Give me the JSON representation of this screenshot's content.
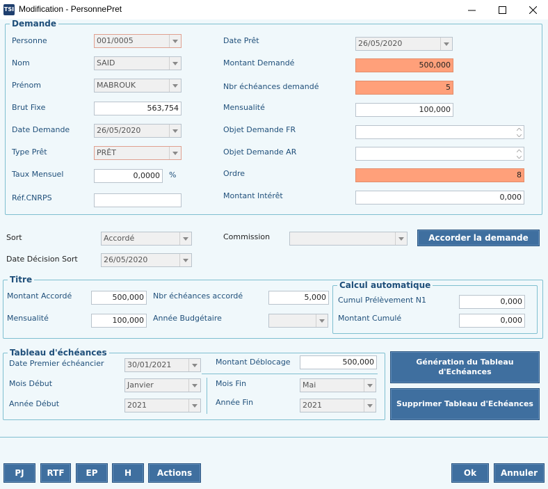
{
  "window": {
    "title": "Modification - PersonnePret",
    "icon_text": "TSI"
  },
  "demande": {
    "legend": "Demande",
    "personne": {
      "label": "Personne",
      "value": "001/0005"
    },
    "nom": {
      "label": "Nom",
      "value": "SAID"
    },
    "prenom": {
      "label": "Prénom",
      "value": "MABROUK"
    },
    "brut_fixe": {
      "label": "Brut Fixe",
      "value": "563,754"
    },
    "date_demande": {
      "label": "Date Demande",
      "value": "26/05/2020"
    },
    "type_pret": {
      "label": "Type Prêt",
      "value": "PRÊT"
    },
    "taux_mensuel": {
      "label": "Taux Mensuel",
      "value": "0,0000",
      "unit": "%"
    },
    "ref_cnrps": {
      "label": "Réf.CNRPS",
      "value": ""
    },
    "date_pret": {
      "label": "Date Prêt",
      "value": "26/05/2020"
    },
    "montant_demande": {
      "label": "Montant Demandé",
      "value": "500,000"
    },
    "nbr_echeances": {
      "label": "Nbr échéances demandé",
      "value": "5"
    },
    "mensualite": {
      "label": "Mensualité",
      "value": "100,000"
    },
    "objet_fr": {
      "label": "Objet Demande FR",
      "value": ""
    },
    "objet_ar": {
      "label": "Objet Demande AR",
      "value": ""
    },
    "ordre": {
      "label": "Ordre",
      "value": "8"
    },
    "montant_interet": {
      "label": "Montant Intérêt",
      "value": "0,000"
    }
  },
  "sort": {
    "sort": {
      "label": "Sort",
      "value": "Accordé"
    },
    "commission": {
      "label": "Commission",
      "value": ""
    },
    "date_decision": {
      "label": "Date Décision Sort",
      "value": "26/05/2020"
    },
    "accorder_label": "Accorder la demande"
  },
  "titre": {
    "legend": "Titre",
    "montant_accorde": {
      "label": "Montant Accordé",
      "value": "500,000"
    },
    "nbr_accorde": {
      "label": "Nbr échéances accordé",
      "value": "5,000"
    },
    "mensualite": {
      "label": "Mensualité",
      "value": "100,000"
    },
    "annee_budgetaire": {
      "label": "Année Budgétaire",
      "value": ""
    }
  },
  "calcul": {
    "legend": "Calcul automatique",
    "cumul": {
      "label": "Cumul Prélèvement N1",
      "value": "0,000"
    },
    "montant_cumule": {
      "label": "Montant Cumulé",
      "value": "0,000"
    }
  },
  "tableau": {
    "legend": "Tableau d'échéances",
    "date_premier": {
      "label": "Date Premier échéancier",
      "value": "30/01/2021"
    },
    "montant_deblocage": {
      "label": "Montant Déblocage",
      "value": "500,000"
    },
    "mois_debut": {
      "label": "Mois Début",
      "value": "Janvier"
    },
    "mois_fin": {
      "label": "Mois Fin",
      "value": "Mai"
    },
    "annee_debut": {
      "label": "Année Début",
      "value": "2021"
    },
    "annee_fin": {
      "label": "Année Fin",
      "value": "2021"
    },
    "generer_label": "Génération du Tableau d'Echéances",
    "supprimer_label": "Supprimer Tableau d'Echéances"
  },
  "footer": {
    "pj": "PJ",
    "rtf": "RTF",
    "ep": "EP",
    "h": "H",
    "actions": "Actions",
    "ok": "Ok",
    "annuler": "Annuler"
  },
  "colors": {
    "required": "#ffa07a",
    "accent": "#3f6f9f",
    "frame": "#7fbfd0"
  }
}
